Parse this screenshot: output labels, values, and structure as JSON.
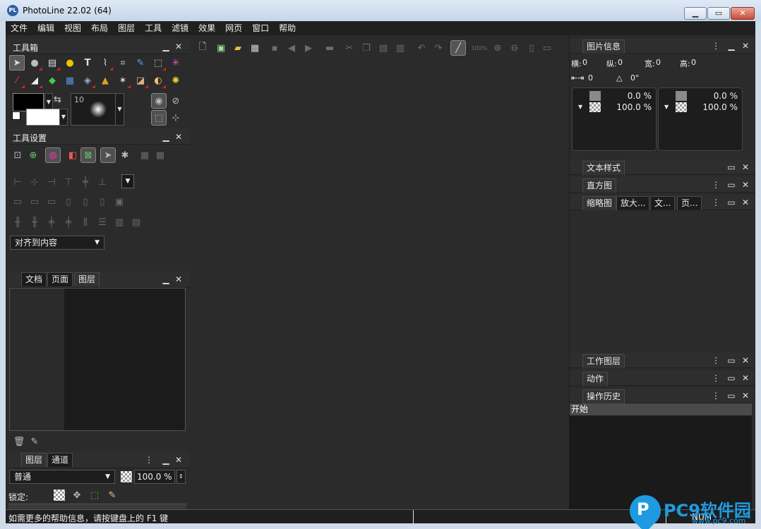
{
  "window": {
    "title": "PhotoLine 22.02 (64)",
    "app_icon_text": "PL"
  },
  "menu": [
    "文件",
    "编辑",
    "视图",
    "布局",
    "图层",
    "工具",
    "滤镜",
    "效果",
    "网页",
    "窗口",
    "帮助"
  ],
  "toolbox": {
    "title": "工具箱",
    "brush_size": "10"
  },
  "tool_settings": {
    "title": "工具设置",
    "align_dropdown": "对齐到内容"
  },
  "doc_panel": {
    "tabs": [
      "文档",
      "页面",
      "图层"
    ]
  },
  "layers_panel": {
    "tabs": [
      "图层",
      "通道"
    ],
    "blend_mode": "普通",
    "opacity": "100.0 %",
    "lock_label": "锁定:"
  },
  "image_info": {
    "tab": "图片信息",
    "fields": [
      {
        "label": "横:",
        "value": "0"
      },
      {
        "label": "纵:",
        "value": "0"
      },
      {
        "label": "宽:",
        "value": "0"
      },
      {
        "label": "高:",
        "value": "0"
      }
    ],
    "width_value": "0",
    "angle_value": "0°",
    "cards": [
      {
        "top_pct": "0.0 %",
        "bottom_pct": "100.0 %"
      },
      {
        "top_pct": "0.0 %",
        "bottom_pct": "100.0 %"
      }
    ]
  },
  "right_panels": {
    "text_style": "文本样式",
    "histogram": "直方图",
    "thumb_tabs": [
      "缩略图",
      "放大...",
      "文...",
      "页..."
    ],
    "work_layer": "工作图层",
    "actions": "动作",
    "history": "操作历史",
    "history_items": [
      "开始"
    ]
  },
  "statusbar": {
    "help_text": "如需更多的帮助信息，请按键盘上的 F1 键",
    "num": "NUM"
  },
  "watermark": {
    "brand": "PC9软件园",
    "url": "www.pc9.com"
  },
  "colors": {
    "background": "#2b2b2b",
    "panel_dark": "#1d1d1d",
    "accent_red": "#d62020"
  }
}
